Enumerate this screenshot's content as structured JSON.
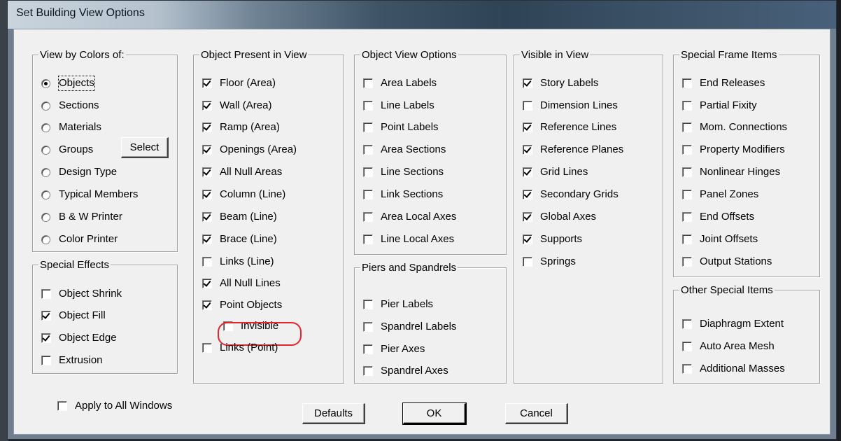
{
  "window": {
    "title": "Set Building View Options"
  },
  "view_by_colors": {
    "title": "View by Colors of:",
    "options": [
      {
        "label": "Objects",
        "selected": true
      },
      {
        "label": "Sections",
        "selected": false
      },
      {
        "label": "Materials",
        "selected": false
      },
      {
        "label": "Groups",
        "selected": false
      },
      {
        "label": "Design Type",
        "selected": false
      },
      {
        "label": "Typical Members",
        "selected": false
      },
      {
        "label": "B & W Printer",
        "selected": false
      },
      {
        "label": "Color Printer",
        "selected": false
      }
    ],
    "select_button": "Select"
  },
  "special_effects": {
    "title": "Special Effects",
    "items": [
      {
        "label": "Object Shrink",
        "checked": false
      },
      {
        "label": "Object Fill",
        "checked": true
      },
      {
        "label": "Object Edge",
        "checked": true
      },
      {
        "label": "Extrusion",
        "checked": false
      }
    ]
  },
  "object_present": {
    "title": "Object Present in View",
    "items": [
      {
        "label": "Floor (Area)",
        "checked": true
      },
      {
        "label": "Wall (Area)",
        "checked": true
      },
      {
        "label": "Ramp (Area)",
        "checked": true
      },
      {
        "label": "Openings (Area)",
        "checked": true
      },
      {
        "label": "All Null Areas",
        "checked": true
      },
      {
        "label": "Column (Line)",
        "checked": true
      },
      {
        "label": "Beam (Line)",
        "checked": true
      },
      {
        "label": "Brace (Line)",
        "checked": true
      },
      {
        "label": "Links (Line)",
        "checked": false
      },
      {
        "label": "All Null Lines",
        "checked": true
      },
      {
        "label": "Point Objects",
        "checked": true
      },
      {
        "label": "Invisible",
        "checked": false
      },
      {
        "label": "Links (Point)",
        "checked": false
      }
    ]
  },
  "object_view_options": {
    "title": "Object View Options",
    "items": [
      {
        "label": "Area Labels",
        "checked": false
      },
      {
        "label": "Line Labels",
        "checked": false
      },
      {
        "label": "Point Labels",
        "checked": false
      },
      {
        "label": "Area Sections",
        "checked": false
      },
      {
        "label": "Line Sections",
        "checked": false
      },
      {
        "label": "Link Sections",
        "checked": false
      },
      {
        "label": "Area Local Axes",
        "checked": false
      },
      {
        "label": "Line Local Axes",
        "checked": false
      }
    ]
  },
  "piers_spandrels": {
    "title": "Piers and Spandrels",
    "items": [
      {
        "label": "Pier Labels",
        "checked": false
      },
      {
        "label": "Spandrel Labels",
        "checked": false
      },
      {
        "label": "Pier Axes",
        "checked": false
      },
      {
        "label": "Spandrel Axes",
        "checked": false
      }
    ]
  },
  "visible_in_view": {
    "title": "Visible in View",
    "items": [
      {
        "label": "Story Labels",
        "checked": true
      },
      {
        "label": "Dimension Lines",
        "checked": false
      },
      {
        "label": "Reference Lines",
        "checked": true
      },
      {
        "label": "Reference Planes",
        "checked": true
      },
      {
        "label": "Grid Lines",
        "checked": true
      },
      {
        "label": "Secondary Grids",
        "checked": true
      },
      {
        "label": "Global Axes",
        "checked": true
      },
      {
        "label": "Supports",
        "checked": true
      },
      {
        "label": "Springs",
        "checked": false
      }
    ]
  },
  "special_frame_items": {
    "title": "Special Frame Items",
    "items": [
      {
        "label": "End Releases",
        "checked": false
      },
      {
        "label": "Partial Fixity",
        "checked": false
      },
      {
        "label": "Mom. Connections",
        "checked": false
      },
      {
        "label": "Property Modifiers",
        "checked": false
      },
      {
        "label": "Nonlinear Hinges",
        "checked": false
      },
      {
        "label": "Panel Zones",
        "checked": false
      },
      {
        "label": "End Offsets",
        "checked": false
      },
      {
        "label": "Joint Offsets",
        "checked": false
      },
      {
        "label": "Output Stations",
        "checked": false
      }
    ]
  },
  "other_special_items": {
    "title": "Other Special Items",
    "items": [
      {
        "label": "Diaphragm Extent",
        "checked": false
      },
      {
        "label": "Auto Area Mesh",
        "checked": false
      },
      {
        "label": "Additional Masses",
        "checked": false
      }
    ]
  },
  "apply_all": {
    "label": "Apply to All Windows",
    "checked": false
  },
  "buttons": {
    "defaults": "Defaults",
    "ok": "OK",
    "cancel": "Cancel"
  },
  "colors": {
    "highlight_ring": "#e8232a"
  }
}
